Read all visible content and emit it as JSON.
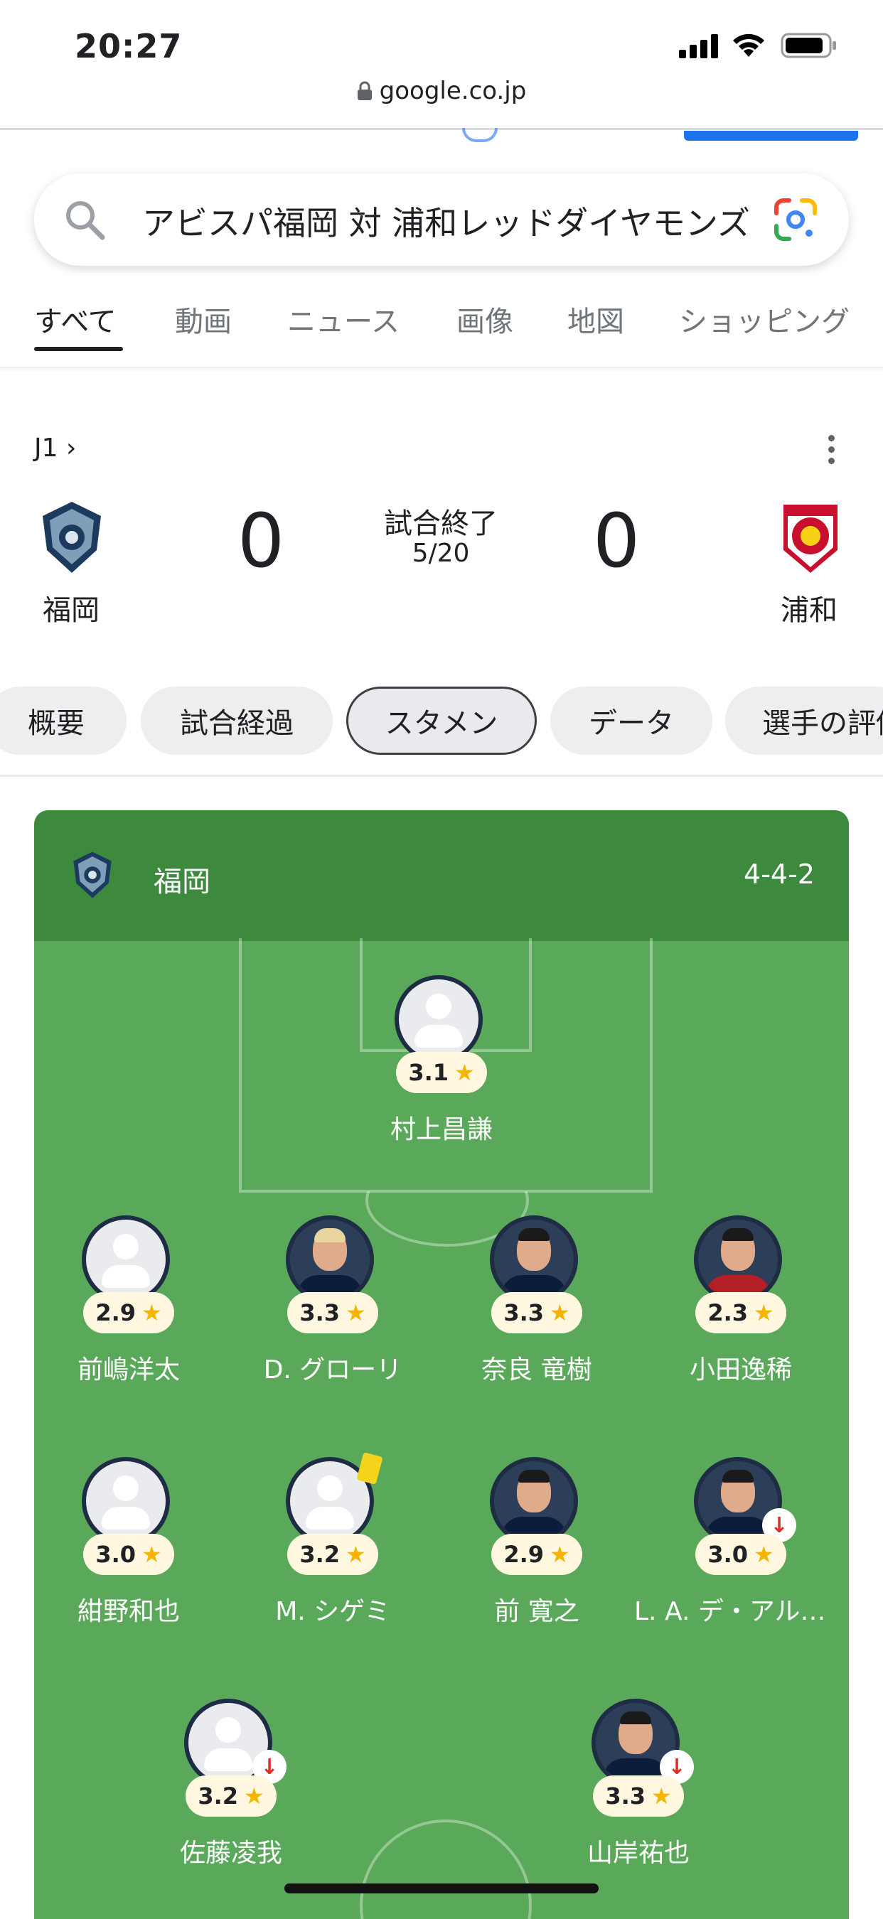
{
  "status_bar": {
    "time": "20:27"
  },
  "url_bar": {
    "domain": "google.co.jp"
  },
  "search": {
    "query": "アビスパ福岡 対 浦和レッドダイヤモンズ"
  },
  "nav_tabs": [
    {
      "label": "すべて",
      "active": true
    },
    {
      "label": "動画"
    },
    {
      "label": "ニュース"
    },
    {
      "label": "画像"
    },
    {
      "label": "地図"
    },
    {
      "label": "ショッピング"
    }
  ],
  "match": {
    "league": "J1 ›",
    "home": {
      "name": "福岡",
      "score": "0"
    },
    "away": {
      "name": "浦和",
      "score": "0"
    },
    "status": "試合終了",
    "date": "5/20"
  },
  "chips": [
    {
      "label": "概要"
    },
    {
      "label": "試合経過"
    },
    {
      "label": "スタメン",
      "active": true
    },
    {
      "label": "データ"
    },
    {
      "label": "選手の評価"
    }
  ],
  "lineup": {
    "team": "福岡",
    "formation": "4-4-2",
    "players": [
      {
        "name": "村上昌謙",
        "rating": "3.1"
      },
      {
        "name": "前嶋洋太",
        "rating": "2.9"
      },
      {
        "name": "D. グローリ",
        "rating": "3.3"
      },
      {
        "name": "奈良 竜樹",
        "rating": "3.3"
      },
      {
        "name": "小田逸稀",
        "rating": "2.3"
      },
      {
        "name": "紺野和也",
        "rating": "3.0"
      },
      {
        "name": "M. シゲミ",
        "rating": "3.2",
        "yellow_card": true
      },
      {
        "name": "前 寛之",
        "rating": "2.9"
      },
      {
        "name": "L. A. デ・アルメイダ",
        "rating": "3.0",
        "substituted": true
      },
      {
        "name": "佐藤凌我",
        "rating": "3.2",
        "substituted": true
      },
      {
        "name": "山岸祐也",
        "rating": "3.3",
        "substituted": true
      }
    ],
    "star_symbol": "★",
    "sub_symbol": "↓"
  },
  "colors": {
    "pitch": "#5aa95a",
    "pitch_header": "#3d8a3f",
    "rating_star": "#f4b400",
    "sub_arrow": "#d93025",
    "google_blue": "#1a73e8"
  }
}
